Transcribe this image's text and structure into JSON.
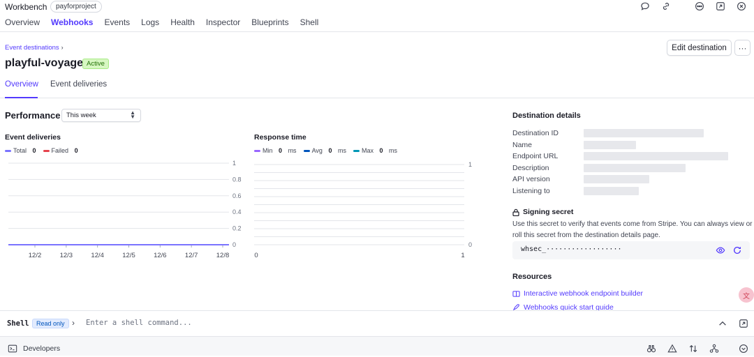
{
  "header": {
    "app_title": "Workbench",
    "project": "payforproject",
    "tabs": [
      {
        "label": "Overview"
      },
      {
        "label": "Webhooks"
      },
      {
        "label": "Events"
      },
      {
        "label": "Logs"
      },
      {
        "label": "Health"
      },
      {
        "label": "Inspector"
      },
      {
        "label": "Blueprints"
      },
      {
        "label": "Shell"
      }
    ],
    "active_tab": "Webhooks",
    "icons": [
      "chat-icon",
      "link-icon",
      "more-icon",
      "expand-icon",
      "close-icon"
    ]
  },
  "destination": {
    "breadcrumb": "Event destinations",
    "name": "playful-voyage",
    "status": "Active",
    "edit_label": "Edit destination",
    "more_label": "···",
    "tabs": [
      "Overview",
      "Event deliveries"
    ]
  },
  "performance": {
    "title": "Performance",
    "range": "This week"
  },
  "charts": {
    "deliveries": {
      "title": "Event deliveries",
      "legend": [
        {
          "name": "Total",
          "value": "0",
          "color": "#7a73ff"
        },
        {
          "name": "Failed",
          "value": "0",
          "color": "#e5424d"
        }
      ]
    },
    "response": {
      "title": "Response time",
      "legend": [
        {
          "name": "Min",
          "value": "0",
          "unit": "ms",
          "color": "#9966ff"
        },
        {
          "name": "Avg",
          "value": "0",
          "unit": "ms",
          "color": "#0055bc"
        },
        {
          "name": "Max",
          "value": "0",
          "unit": "ms",
          "color": "#0097b5"
        }
      ]
    }
  },
  "chart_data": [
    {
      "type": "line",
      "title": "Event deliveries",
      "x": [
        "12/2",
        "12/3",
        "12/4",
        "12/5",
        "12/6",
        "12/7",
        "12/8"
      ],
      "series": [
        {
          "name": "Total",
          "values": [
            0,
            0,
            0,
            0,
            0,
            0,
            0
          ]
        },
        {
          "name": "Failed",
          "values": [
            0,
            0,
            0,
            0,
            0,
            0,
            0
          ]
        }
      ],
      "yticks": [
        "1",
        "0.8",
        "0.6",
        "0.4",
        "0.2",
        "0"
      ],
      "ylim": [
        0,
        1
      ],
      "grid": true
    },
    {
      "type": "line",
      "title": "Response time",
      "xticks": [
        "0",
        "1"
      ],
      "yticks": [
        "1",
        "0"
      ],
      "series": [
        {
          "name": "Min",
          "values": []
        },
        {
          "name": "Avg",
          "values": []
        },
        {
          "name": "Max",
          "values": []
        }
      ],
      "ylim": [
        0,
        1
      ],
      "grid": true
    }
  ],
  "details": {
    "title": "Destination details",
    "rows": [
      {
        "label": "Destination ID"
      },
      {
        "label": "Name"
      },
      {
        "label": "Endpoint URL"
      },
      {
        "label": "Description"
      },
      {
        "label": "API version"
      },
      {
        "label": "Listening to"
      }
    ],
    "secret": {
      "title": "Signing secret",
      "description": "Use this secret to verify that events come from Stripe. You can always view or roll this secret from the destination details page.",
      "value": "whsec_··················"
    },
    "resources": {
      "title": "Resources",
      "links": [
        {
          "label": "Interactive webhook endpoint builder"
        },
        {
          "label": "Webhooks quick start guide"
        }
      ]
    }
  },
  "shell": {
    "label": "Shell",
    "badge": "Read only",
    "placeholder": "Enter a shell command..."
  },
  "developers": {
    "label": "Developers"
  }
}
